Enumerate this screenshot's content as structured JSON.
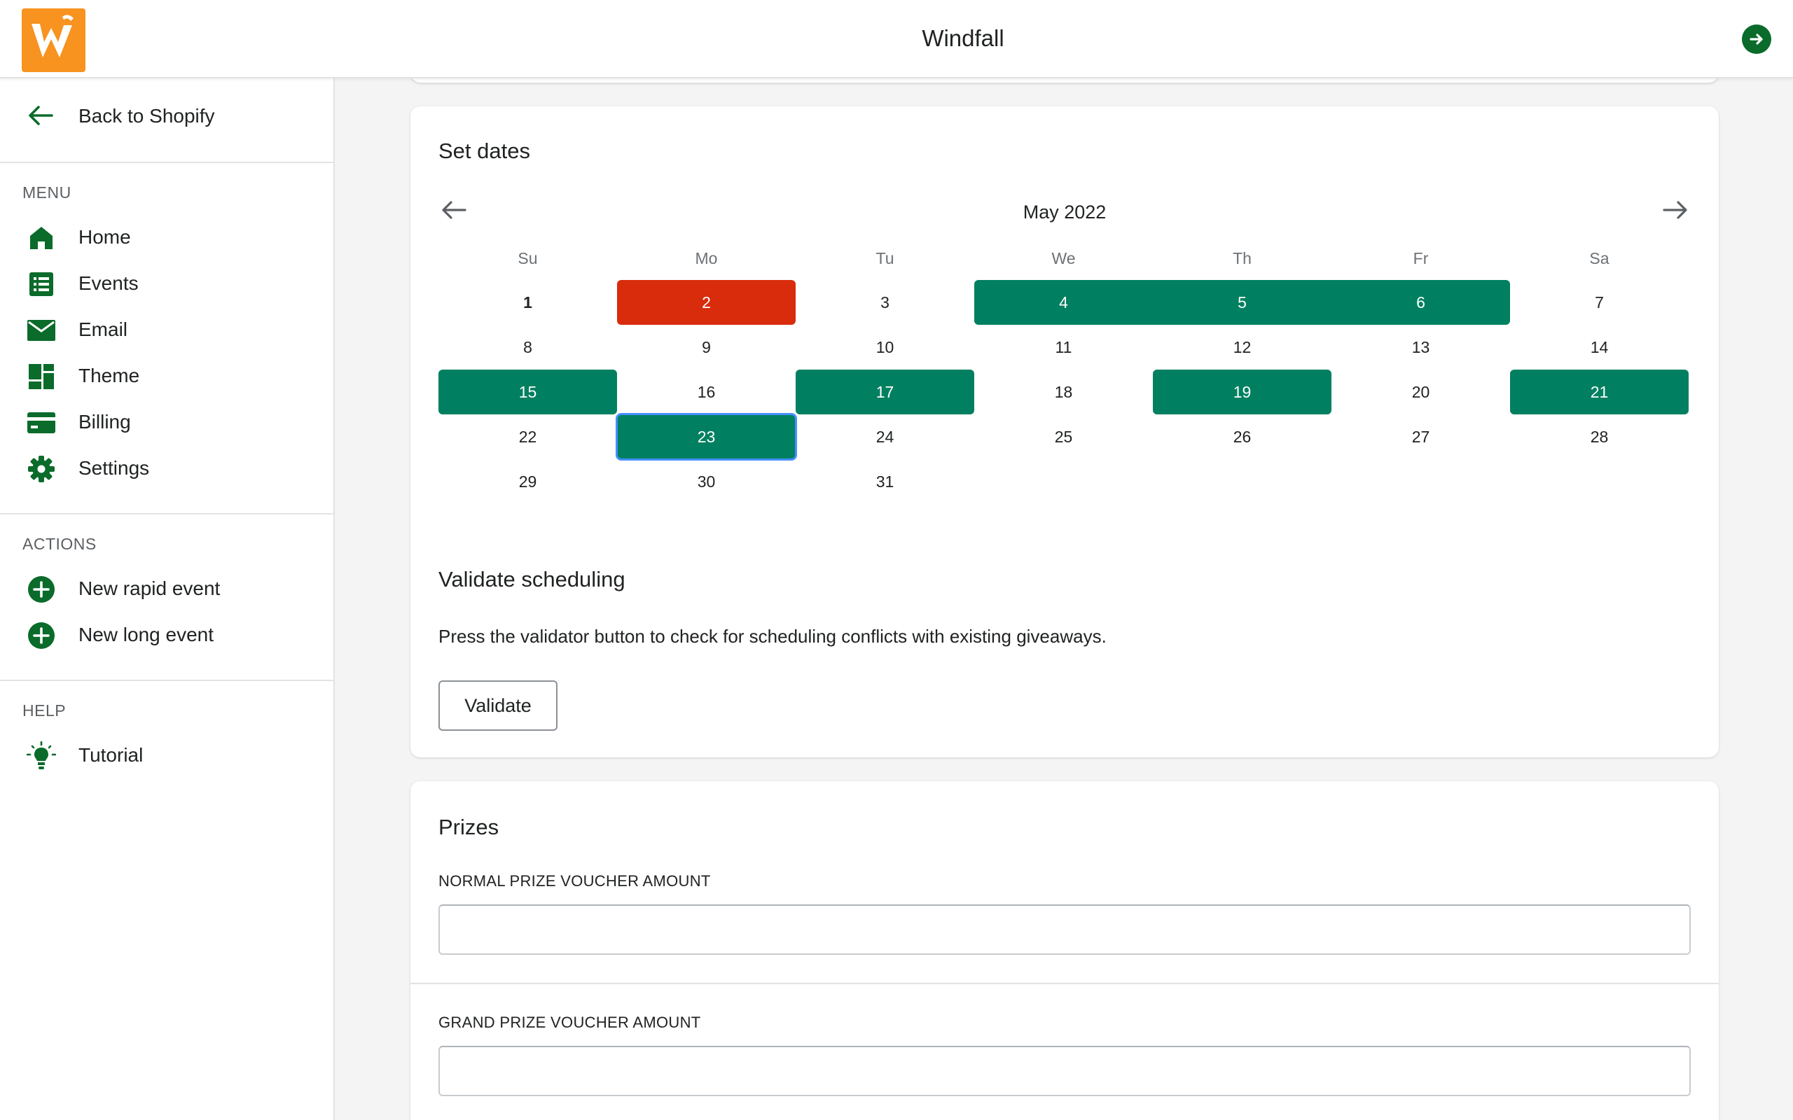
{
  "header": {
    "title": "Windfall"
  },
  "sidebar": {
    "back_label": "Back to Shopify",
    "menu_heading": "MENU",
    "menu_items": [
      {
        "label": "Home",
        "icon": "home-icon"
      },
      {
        "label": "Events",
        "icon": "list-icon"
      },
      {
        "label": "Email",
        "icon": "envelope-icon"
      },
      {
        "label": "Theme",
        "icon": "theme-icon"
      },
      {
        "label": "Billing",
        "icon": "credit-card-icon"
      },
      {
        "label": "Settings",
        "icon": "gear-icon"
      }
    ],
    "actions_heading": "ACTIONS",
    "action_items": [
      {
        "label": "New rapid event",
        "icon": "plus-circle-icon"
      },
      {
        "label": "New long event",
        "icon": "plus-circle-icon"
      }
    ],
    "help_heading": "HELP",
    "help_items": [
      {
        "label": "Tutorial",
        "icon": "lightbulb-icon"
      }
    ]
  },
  "dates_card": {
    "title": "Set dates",
    "calendar": {
      "month_label": "May 2022",
      "weekdays": [
        "Su",
        "Mo",
        "Tu",
        "We",
        "Th",
        "Fr",
        "Sa"
      ],
      "weeks": [
        [
          "1",
          "2",
          "3",
          "4",
          "5",
          "6",
          "7"
        ],
        [
          "8",
          "9",
          "10",
          "11",
          "12",
          "13",
          "14"
        ],
        [
          "15",
          "16",
          "17",
          "18",
          "19",
          "20",
          "21"
        ],
        [
          "22",
          "23",
          "24",
          "25",
          "26",
          "27",
          "28"
        ],
        [
          "29",
          "30",
          "31",
          "",
          "",
          "",
          ""
        ]
      ],
      "today": "1",
      "selected_days": [
        "4",
        "5",
        "6",
        "15",
        "17",
        "19",
        "21",
        "23"
      ],
      "conflict_days": [
        "2"
      ],
      "focused_day": "23"
    },
    "validate_heading": "Validate scheduling",
    "validate_help": "Press the validator button to check for scheduling conflicts with existing giveaways.",
    "validate_button": "Validate"
  },
  "prizes_card": {
    "title": "Prizes",
    "normal_label": "NORMAL PRIZE VOUCHER AMOUNT",
    "normal_value": "",
    "grand_label": "GRAND PRIZE VOUCHER AMOUNT",
    "grand_value": ""
  },
  "colors": {
    "brand_green": "#0a6b2a",
    "selected_day": "#008060",
    "conflict_day": "#d82c0d",
    "logo_orange": "#f7931e",
    "focus_ring": "#458fff"
  }
}
